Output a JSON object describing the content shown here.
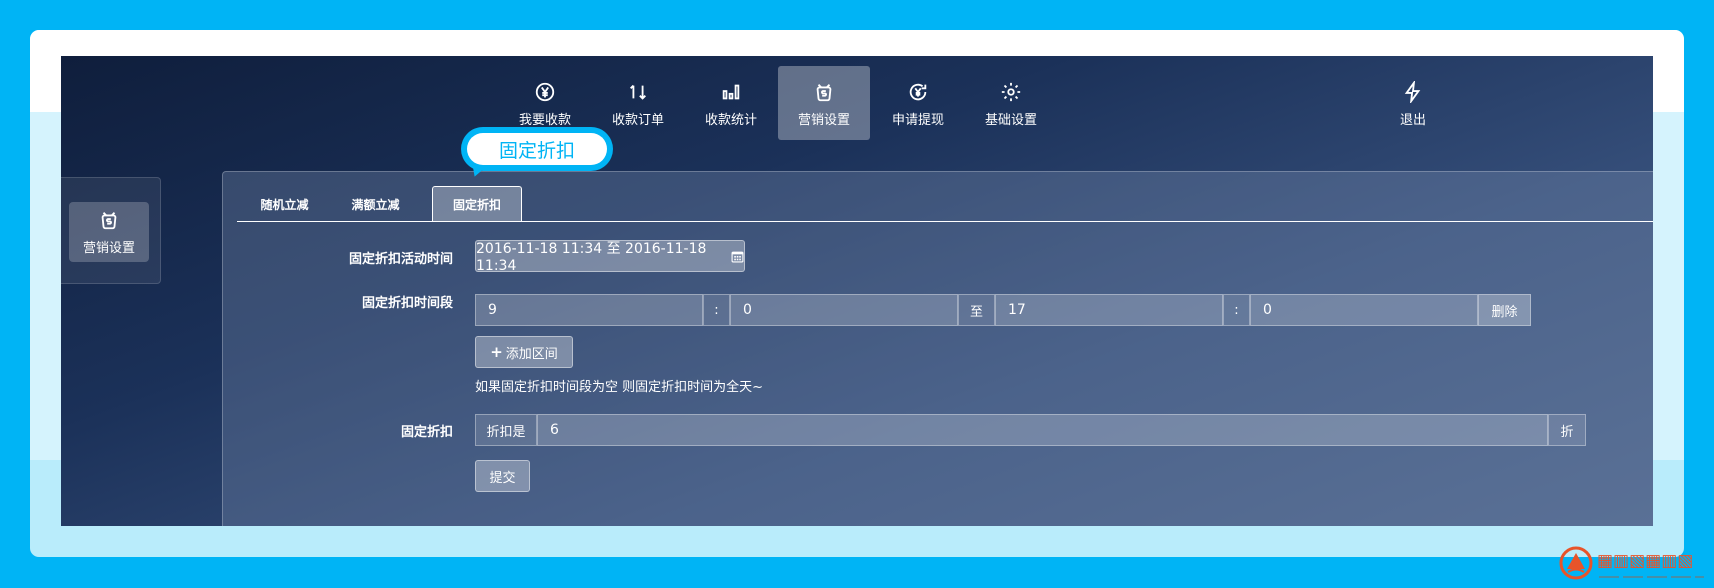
{
  "nav": {
    "items": [
      {
        "label": "我要收款",
        "icon": "yen-circle-icon"
      },
      {
        "label": "收款订单",
        "icon": "sort-arrows-icon"
      },
      {
        "label": "收款统计",
        "icon": "bar-chart-icon"
      },
      {
        "label": "营销设置",
        "icon": "money-bag-icon"
      },
      {
        "label": "申请提现",
        "icon": "withdraw-icon"
      },
      {
        "label": "基础设置",
        "icon": "gear-icon"
      }
    ],
    "active_label": "营销设置",
    "logout_label": "退出"
  },
  "callout": {
    "text": "固定折扣"
  },
  "sidebar": {
    "item_label": "营销设置"
  },
  "tabs": [
    {
      "label": "随机立减"
    },
    {
      "label": "满额立减"
    },
    {
      "label": "固定折扣",
      "active": true
    }
  ],
  "form": {
    "activity_time": {
      "label": "固定折扣活动时间",
      "value": "2016-11-18 11:34 至 2016-11-18 11:34"
    },
    "time_period": {
      "label": "固定折扣时间段",
      "start_hour": "9",
      "colon": ":",
      "start_minute": "0",
      "to_label": "至",
      "end_hour": "17",
      "end_minute": "0",
      "delete_label": "删除",
      "add_label": "添加区间",
      "hint": "如果固定折扣时间段为空 则固定折扣时间为全天~"
    },
    "discount": {
      "label": "固定折扣",
      "prefix": "折扣是",
      "value": "6",
      "suffix": "折"
    },
    "submit_label": "提交"
  },
  "colors": {
    "accent": "#00b4f5",
    "brand_logo": "#e8542a"
  }
}
